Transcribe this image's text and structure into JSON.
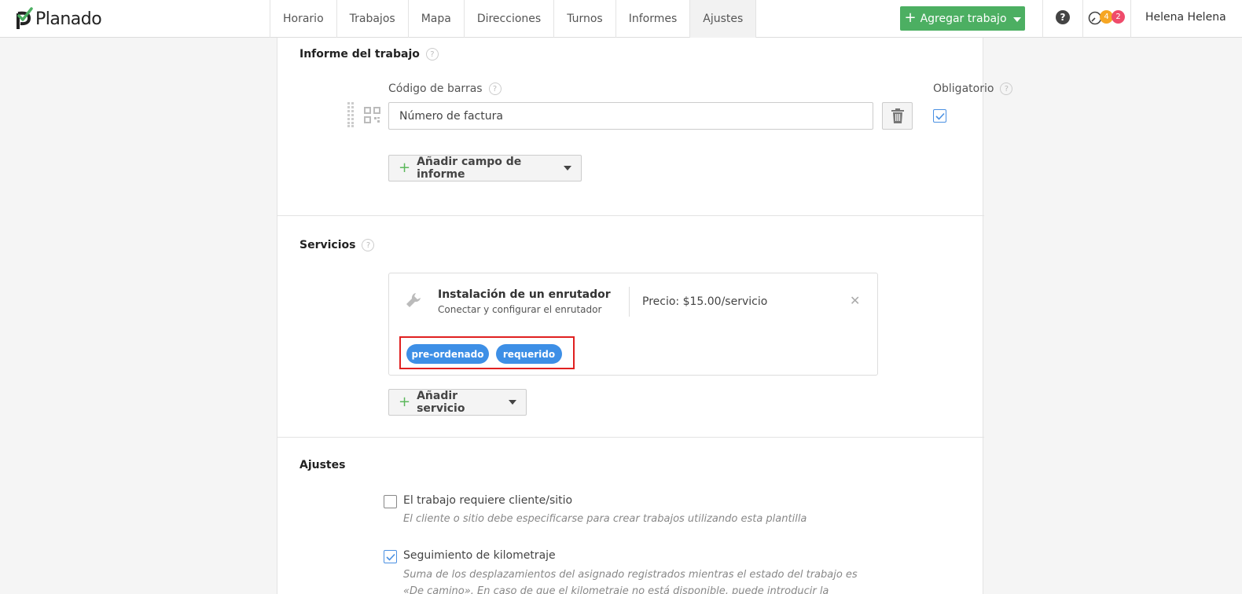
{
  "app": {
    "brand": "Planado"
  },
  "nav": {
    "items": [
      {
        "label": "Horario"
      },
      {
        "label": "Trabajos"
      },
      {
        "label": "Mapa"
      },
      {
        "label": "Direcciones"
      },
      {
        "label": "Turnos"
      },
      {
        "label": "Informes"
      },
      {
        "label": "Ajustes",
        "active": true
      }
    ],
    "add_job_label": "Agregar trabajo",
    "help_glyph": "?",
    "badges": {
      "orange": "4",
      "red": "2"
    },
    "user_name": "Helena Helena"
  },
  "report": {
    "title": "Informe del trabajo",
    "field_type_label": "Código de barras",
    "required_label": "Obligatorio",
    "field_value": "Número de factura",
    "field_required_checked": true,
    "add_field_label": "Añadir campo de informe"
  },
  "services": {
    "title": "Servicios",
    "items": [
      {
        "name": "Instalación de un enrutador",
        "description": "Conectar y configurar el enrutador",
        "price": "Precio: $15.00/servicio",
        "tags": [
          "pre-ordenado",
          "requerido"
        ]
      }
    ],
    "add_service_label": "Añadir servicio"
  },
  "settings": {
    "title": "Ajustes",
    "options": [
      {
        "label": "El trabajo requiere cliente/sitio",
        "description": "El cliente o sitio debe especificarse para crear trabajos utilizando esta plantilla",
        "checked": false
      },
      {
        "label": "Seguimiento de kilometraje",
        "description": "Suma de los desplazamientos del asignado registrados mientras el estado del trabajo es «De camino». En caso de que el kilometraje no está disponible, puede introducir la estimación aquí.",
        "checked": true
      }
    ]
  },
  "colors": {
    "accent_green": "#4caf62",
    "tag_blue": "#3d8fe6",
    "highlight_red": "#e02020",
    "badge_orange": "#f6a623",
    "badge_red": "#ef4b6b"
  }
}
